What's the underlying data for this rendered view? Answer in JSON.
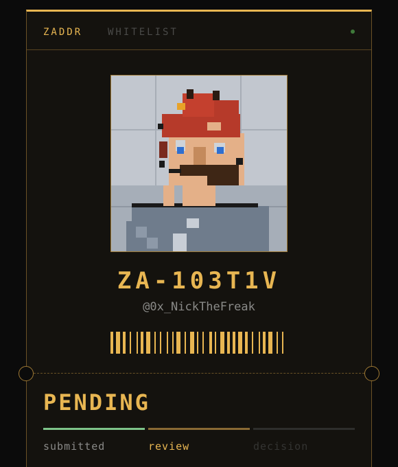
{
  "header": {
    "brand": "ZADDR",
    "section": "WHITELIST"
  },
  "profile": {
    "code": "ZA-103T1V",
    "handle": "@0x_NickTheFreak",
    "avatar_icon": "pixel-art-avatar"
  },
  "status": {
    "label": "PENDING"
  },
  "progress": {
    "steps": [
      {
        "label": "submitted",
        "state": "done"
      },
      {
        "label": "review",
        "state": "current"
      },
      {
        "label": "decision",
        "state": "upcoming"
      }
    ]
  },
  "colors": {
    "accent": "#e8b652",
    "done": "#7ec48a",
    "current": "#8a6a34",
    "upcoming": "#2e2e2c",
    "background": "#0b0b0b"
  }
}
